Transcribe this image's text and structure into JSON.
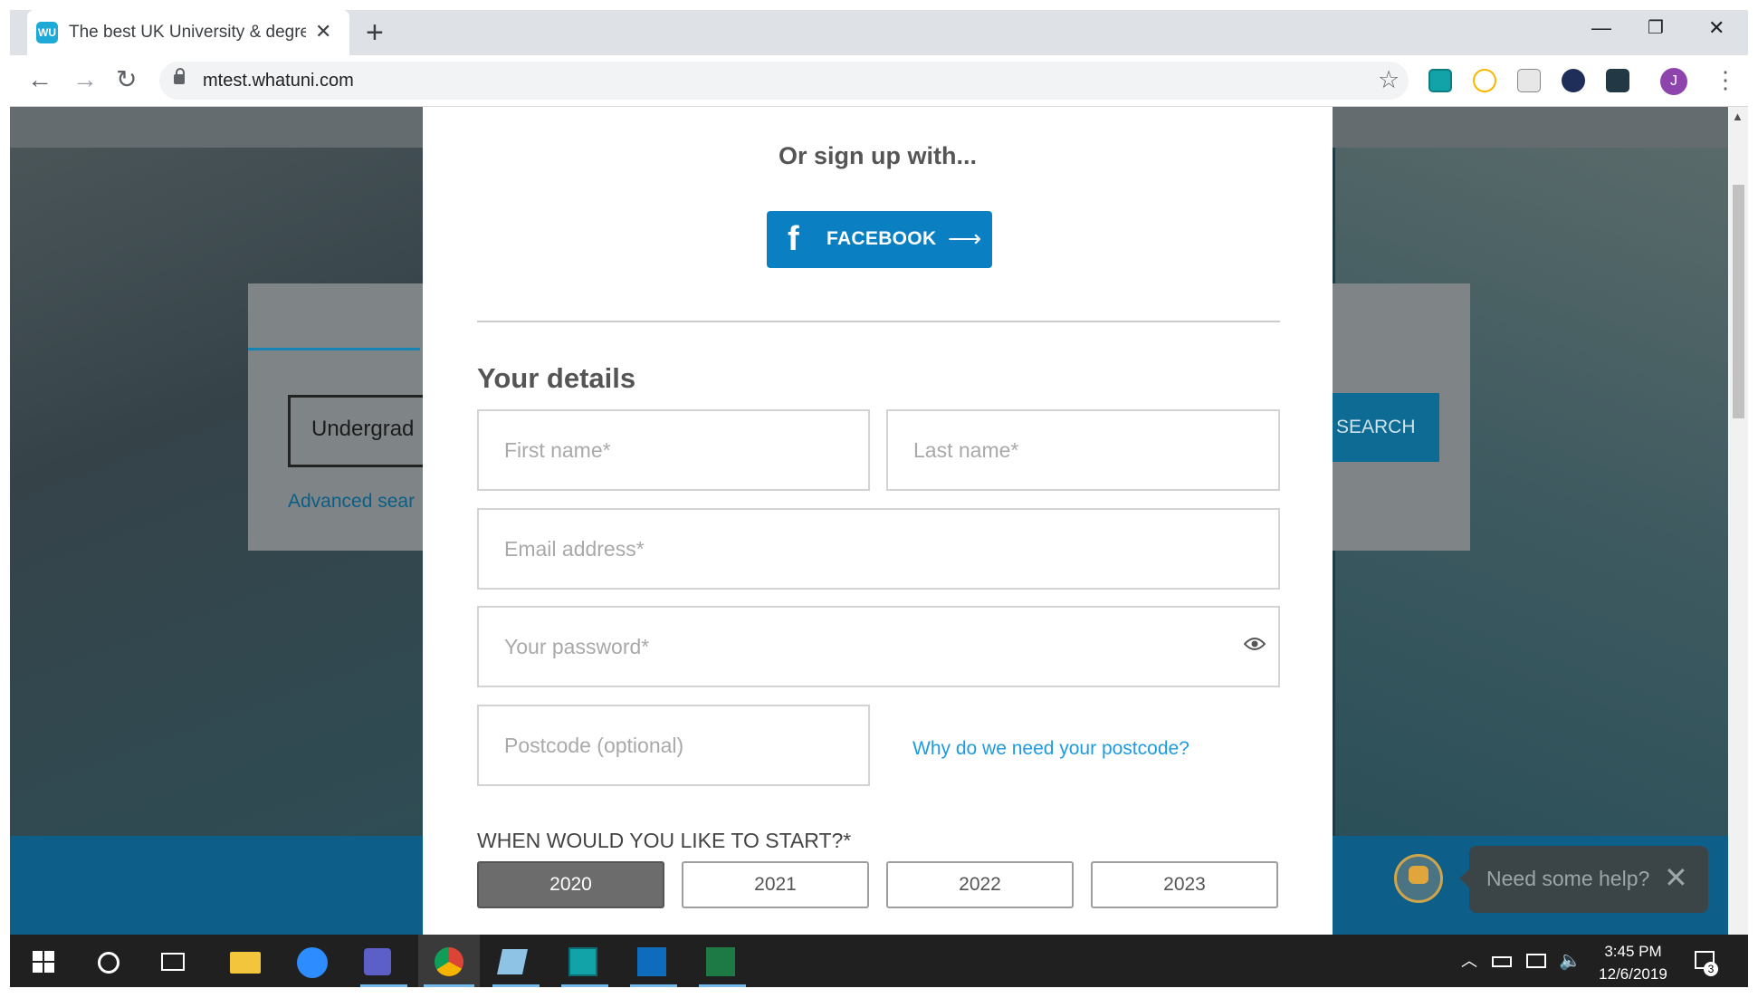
{
  "browser": {
    "tab_title": "The best UK University & degree",
    "tab_favicon_text": "WU",
    "url": "mtest.whatuni.com",
    "avatar_letter": "J"
  },
  "background_page": {
    "search_input_value": "Undergrad",
    "advanced_search_label": "Advanced sear",
    "search_button_label": "SEARCH"
  },
  "modal": {
    "signup_with": "Or sign up with...",
    "facebook_label": "FACEBOOK",
    "details_heading": "Your details",
    "first_name_placeholder": "First name*",
    "last_name_placeholder": "Last name*",
    "email_placeholder": "Email address*",
    "password_placeholder": "Your password*",
    "postcode_placeholder": "Postcode (optional)",
    "postcode_link": "Why do we need your postcode?",
    "start_question": "WHEN WOULD YOU LIKE TO START?*",
    "years": [
      "2020",
      "2021",
      "2022",
      "2023"
    ],
    "selected_year": "2020"
  },
  "help_widget": {
    "text": "Need some help?"
  },
  "taskbar": {
    "time": "3:45 PM",
    "date": "12/6/2019",
    "notification_count": "3"
  },
  "colors": {
    "facebook_blue": "#0a7fc2",
    "link_blue": "#1e9be0",
    "selected_year_bg": "#6c6c6c"
  }
}
